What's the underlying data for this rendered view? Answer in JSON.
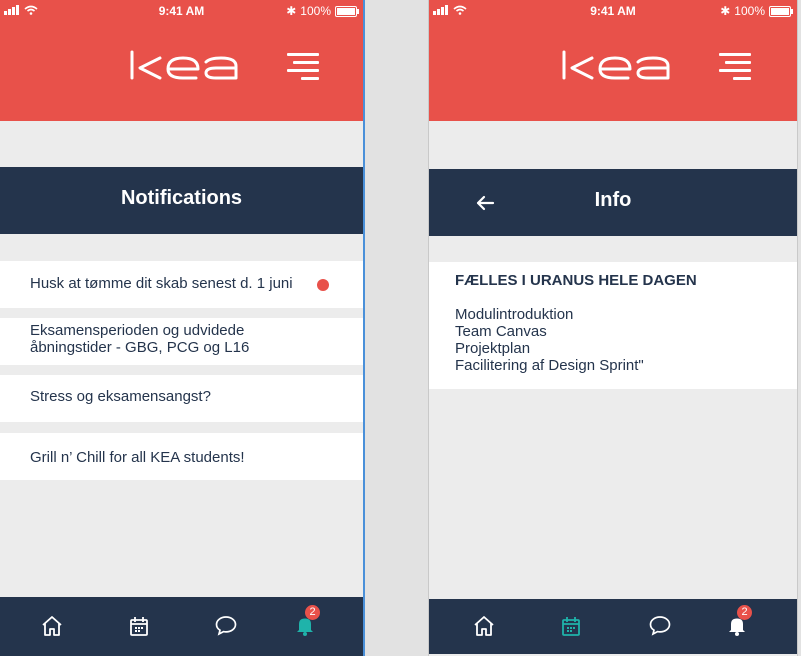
{
  "status_bar": {
    "time": "9:41 AM",
    "battery": "100%"
  },
  "brand": {
    "logo_text": "kea",
    "header_color": "#e8514a",
    "navy": "#24344c",
    "accent_teal": "#1fb3aa"
  },
  "left_screen": {
    "title": "Notifications",
    "notifications": [
      {
        "text": "Husk at tømme dit skab senest d. 1 juni",
        "unread": true
      },
      {
        "text": "Eksamensperioden og udvidede åbningstider - GBG, PCG og L16",
        "unread": false
      },
      {
        "text": "Stress og eksamensangst?",
        "unread": false
      },
      {
        "text": "Grill n’ Chill for all KEA students!",
        "unread": false
      }
    ],
    "tabbar": {
      "active": "bell",
      "badge": "2"
    }
  },
  "right_screen": {
    "title": "Info",
    "back_icon": "arrow-left-icon",
    "info": {
      "heading": "FÆLLES I URANUS HELE DAGEN",
      "lines": [
        "Modulintroduktion",
        "Team Canvas",
        "Projektplan",
        "Facilitering af Design Sprint\""
      ]
    },
    "tabbar": {
      "active": "calendar",
      "badge": "2"
    }
  },
  "tab_icons": [
    "home-icon",
    "calendar-icon",
    "chat-icon",
    "bell-icon"
  ]
}
